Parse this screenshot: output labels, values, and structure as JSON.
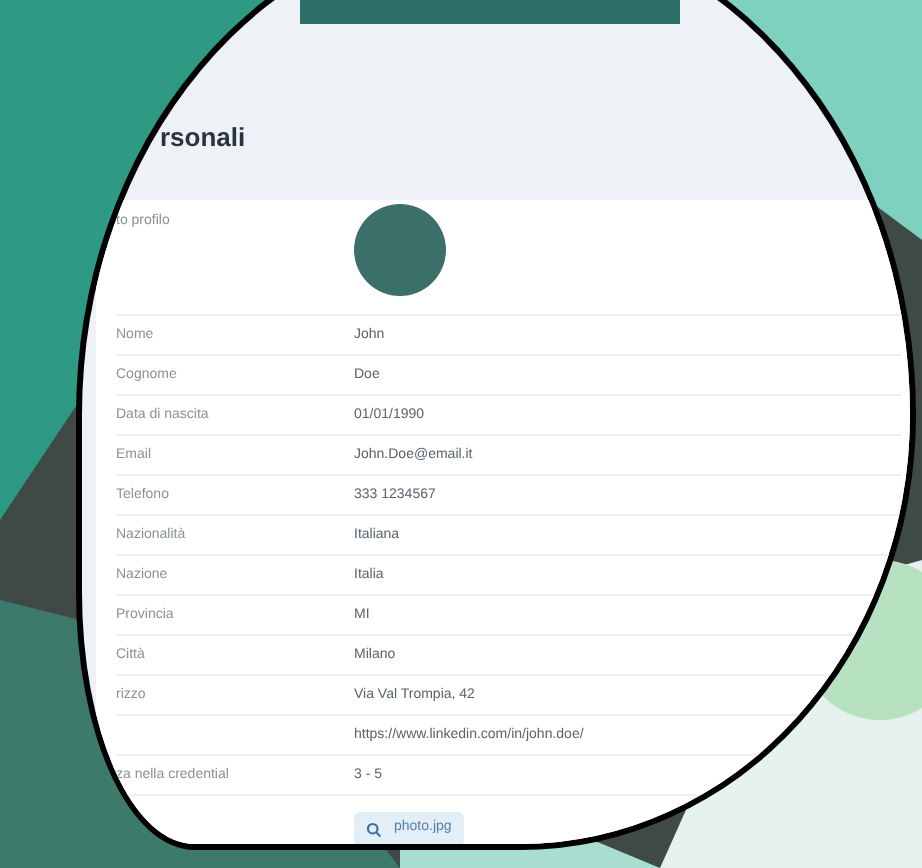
{
  "section": {
    "title": "rsonali"
  },
  "photo": {
    "label": "to profilo"
  },
  "fields": [
    {
      "label": "Nome",
      "value": "John"
    },
    {
      "label": "Cognome",
      "value": "Doe"
    },
    {
      "label": "Data di nascita",
      "value": "01/01/1990"
    },
    {
      "label": "Email",
      "value": "John.Doe@email.it"
    },
    {
      "label": "Telefono",
      "value": "333 1234567"
    },
    {
      "label": "Nazionalità",
      "value": "Italiana"
    },
    {
      "label": "Nazione",
      "value": "Italia"
    },
    {
      "label": "Provincia",
      "value": "MI"
    },
    {
      "label": "Città",
      "value": "Milano"
    },
    {
      "label": "rizzo",
      "value": "Via Val Trompia, 42"
    },
    {
      "value": "https://www.linkedin.com/in/john.doe/"
    },
    {
      "label": "za nella credential",
      "value": "3 - 5"
    }
  ],
  "file_button": {
    "label": "photo.jpg"
  }
}
